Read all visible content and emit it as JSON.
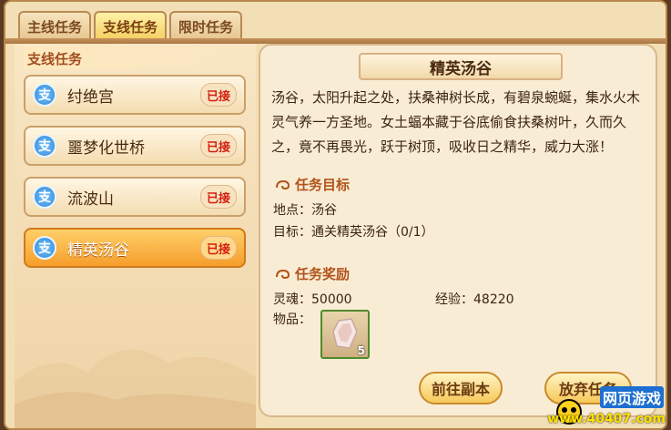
{
  "tabs": [
    {
      "label": "主线任务",
      "active": false
    },
    {
      "label": "支线任务",
      "active": true
    },
    {
      "label": "限时任务",
      "active": false
    }
  ],
  "list_title": "支线任务",
  "quests": [
    {
      "badge": "支",
      "name": "纣绝宫",
      "status": "已接",
      "active": false
    },
    {
      "badge": "支",
      "name": "噩梦化世桥",
      "status": "已接",
      "active": false
    },
    {
      "badge": "支",
      "name": "流波山",
      "status": "已接",
      "active": false
    },
    {
      "badge": "支",
      "name": "精英汤谷",
      "status": "已接",
      "active": true
    }
  ],
  "detail": {
    "title": "精英汤谷",
    "description": "汤谷，太阳升起之处，扶桑神树长成，有碧泉蜿蜒，集水火木灵气养一方圣地。女土蝠本藏于谷底偷食扶桑树叶，久而久之，竟不再畏光，跃于树顶，吸收日之精华，威力大涨！",
    "objective_title": "任务目标",
    "location": "地点：汤谷",
    "target": "目标：通关精英汤谷（0/1）",
    "reward_title": "任务奖励",
    "soul": "灵魂：50000",
    "exp": "经验：48220",
    "items_label": "物品：",
    "item_count": "5"
  },
  "buttons": {
    "goto": "前往副本",
    "abandon": "放弃任务"
  },
  "watermark": {
    "line1": "网页游戏",
    "line2": "www.40407.com"
  },
  "colors": {
    "accent": "#f59e2b",
    "status_red": "#d21e10",
    "section_title": "#b0531b"
  }
}
